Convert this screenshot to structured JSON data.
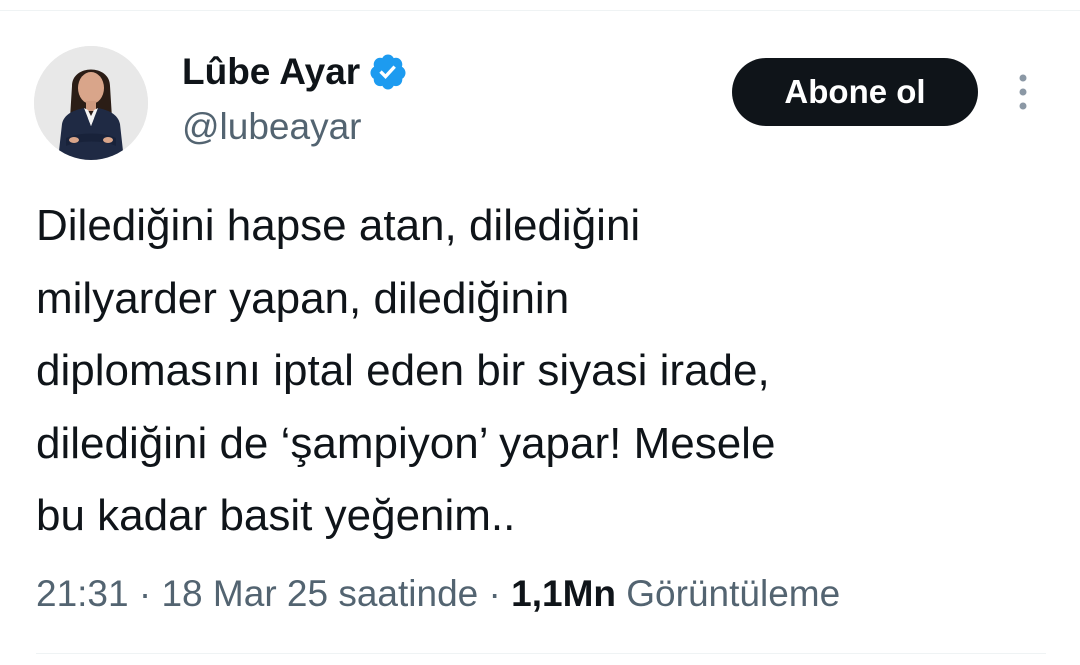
{
  "author": {
    "display_name": "Lûbe Ayar",
    "handle": "@lubeayar",
    "verified_color": "#1d9bf0"
  },
  "actions": {
    "subscribe_label": "Abone ol",
    "more_icon": "more-vertical-icon"
  },
  "tweet": {
    "lines": [
      "Dilediğini hapse atan, dilediğini",
      "milyarder yapan, dilediğinin",
      "diplomasını iptal eden bir siyasi irade,",
      "dilediğini de ‘şampiyon’ yapar! Mesele",
      "bu kadar basit yeğenim.."
    ]
  },
  "meta": {
    "time": "21:31",
    "separator": "·",
    "date": "18 Mar 25 saatinde",
    "views_count": "1,1Mn",
    "views_label": "Görüntüleme"
  },
  "colors": {
    "text_primary": "#0f1419",
    "text_secondary": "#536471",
    "button_bg": "#0f1419",
    "divider": "#eff3f4"
  }
}
